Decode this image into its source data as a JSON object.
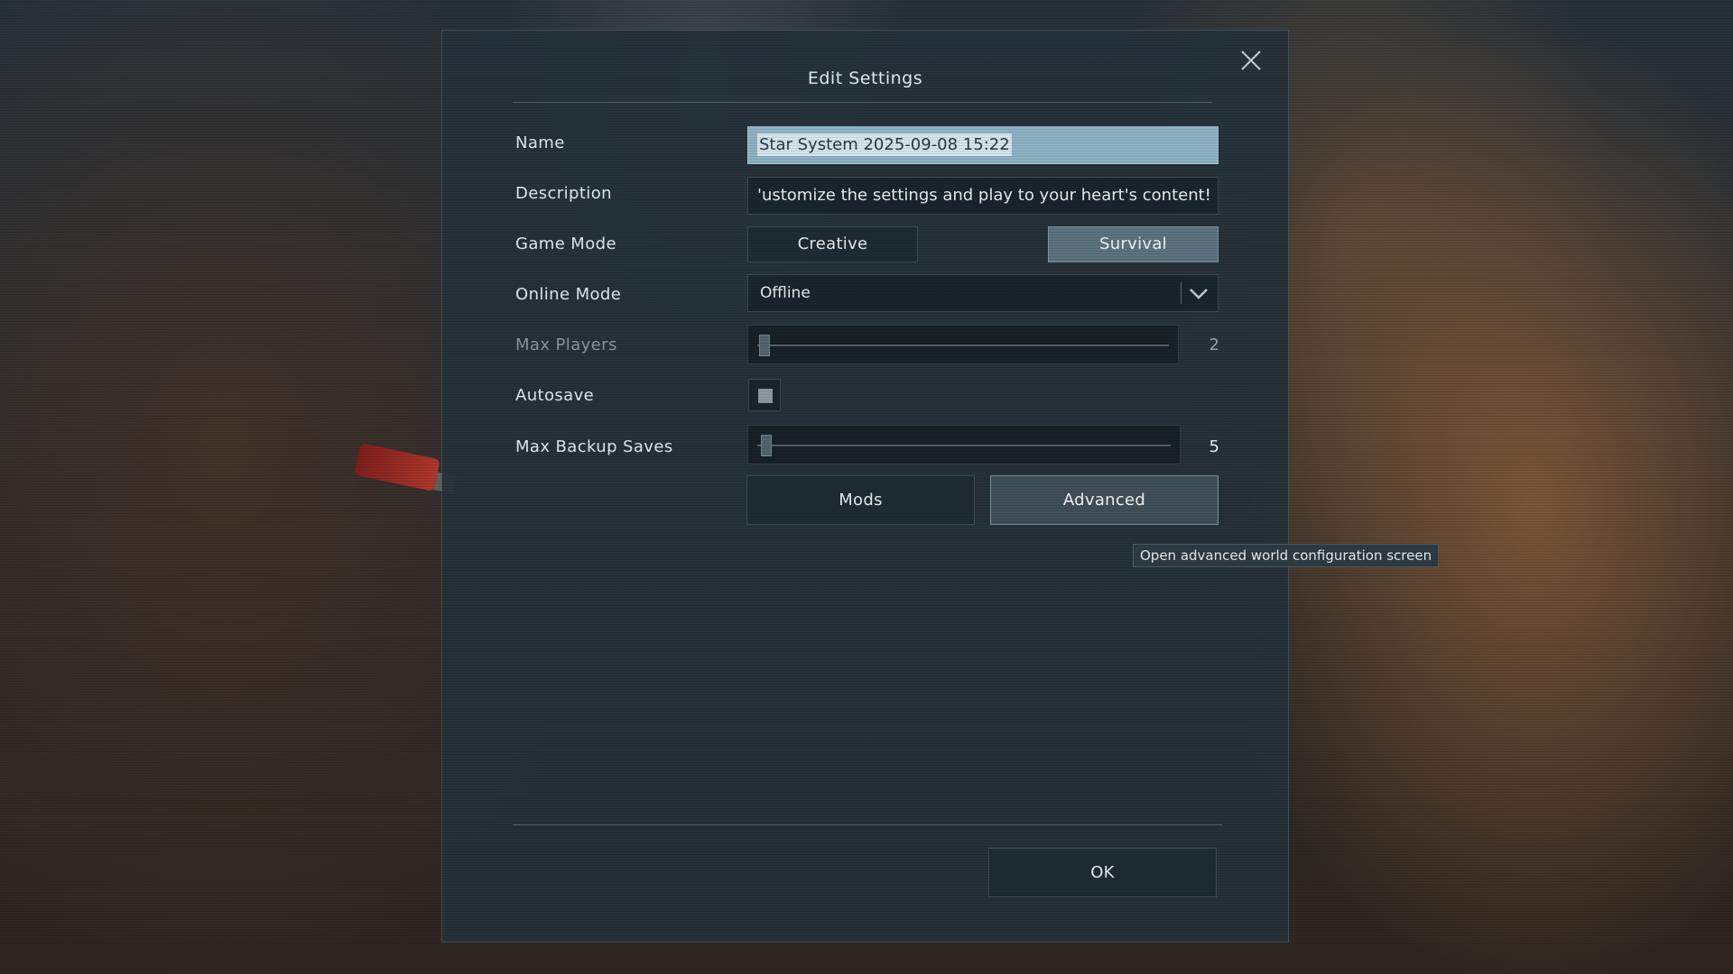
{
  "dialog": {
    "title": "Edit Settings",
    "close_icon": "close-icon"
  },
  "fields": {
    "name_label": "Name",
    "name_value": "Star System 2025-09-08 15:22",
    "description_label": "Description",
    "description_value": "'ustomize the settings and play to your heart's content!",
    "game_mode_label": "Game Mode",
    "game_mode_options": [
      "Creative",
      "Survival"
    ],
    "game_mode_selected": "Survival",
    "online_mode_label": "Online Mode",
    "online_mode_value": "Offline",
    "max_players_label": "Max Players",
    "max_players_value": "2",
    "autosave_label": "Autosave",
    "autosave_checked": true,
    "max_backup_label": "Max Backup Saves",
    "max_backup_value": "5"
  },
  "buttons": {
    "mods": "Mods",
    "advanced": "Advanced",
    "ok": "OK"
  },
  "tooltip": {
    "text": "Open advanced world configuration screen"
  },
  "colors": {
    "accent_active": "#5d7380",
    "name_field_bg": "#8fb3c5",
    "dialog_bg": "#26323a"
  }
}
